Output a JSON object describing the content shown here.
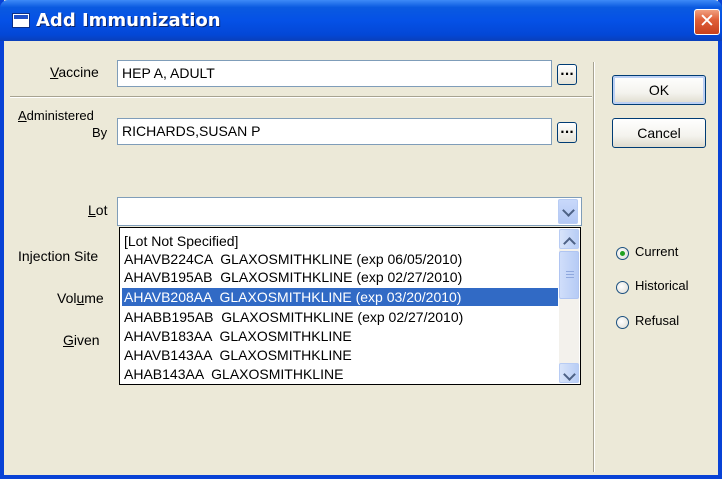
{
  "window": {
    "title": "Add Immunization",
    "close_glyph": "✕"
  },
  "form": {
    "vaccine_label_u": "V",
    "vaccine_label_rest": "accine",
    "vaccine_value": "HEP A, ADULT",
    "administered_label_u": "A",
    "administered_label_rest": "dministered",
    "administered_label_line2": "By",
    "administered_value": "RICHARDS,SUSAN P",
    "lot_label_u": "L",
    "lot_label_rest": "ot",
    "lot_value": "",
    "injection_site_label": "Injection Site",
    "volume_label_pre": "Vol",
    "volume_label_u": "u",
    "volume_label_post": "me",
    "given_label_u": "G",
    "given_label_rest": "iven",
    "ellipsis": "..."
  },
  "lot_options": [
    "[Lot Not Specified]",
    "AHAVB224CA  GLAXOSMITHKLINE (exp 06/05/2010)",
    "AHAVB195AB  GLAXOSMITHKLINE (exp 02/27/2010)",
    "AHAVB208AA  GLAXOSMITHKLINE (exp 03/20/2010)",
    "AHABB195AB  GLAXOSMITHKLINE (exp 02/27/2010)",
    "AHAVB183AA  GLAXOSMITHKLINE",
    "AHAVB143AA  GLAXOSMITHKLINE",
    "AHAB143AA  GLAXOSMITHKLINE"
  ],
  "lot_selected_index": 3,
  "buttons": {
    "ok": "OK",
    "cancel": "Cancel"
  },
  "status_options": [
    {
      "label": "Current",
      "checked": true
    },
    {
      "label": "Historical",
      "checked": false
    },
    {
      "label": "Refusal",
      "checked": false
    }
  ],
  "colors": {
    "titlebar": "#0551e6",
    "selection": "#316ac5",
    "dialog_bg": "#ece9d8"
  }
}
